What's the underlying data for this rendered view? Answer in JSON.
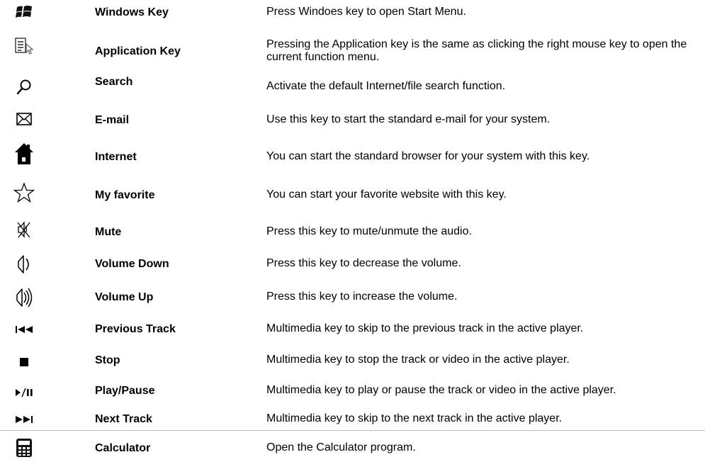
{
  "keys": [
    {
      "icon": "windows-logo-icon",
      "name": "Windows Key",
      "description": "Press Windoes key to open Start Menu."
    },
    {
      "icon": "application-menu-icon",
      "name": "Application Key",
      "description": "Pressing the Application key is the same as clicking the right mouse key to open the current function menu."
    },
    {
      "icon": "search-icon",
      "name": "Search",
      "description": "Activate the default Internet/file search function."
    },
    {
      "icon": "envelope-icon",
      "name": "E-mail",
      "description": "Use this key to start the standard e-mail for your system."
    },
    {
      "icon": "home-icon",
      "name": "Internet",
      "description": "You can start the standard browser for your system with this key."
    },
    {
      "icon": "star-icon",
      "name": "My favorite",
      "description": "You can start your favorite website with this key."
    },
    {
      "icon": "mute-icon",
      "name": "Mute",
      "description": "Press this key to mute/unmute the audio."
    },
    {
      "icon": "volume-down-icon",
      "name": "Volume Down",
      "description": "Press this key to decrease the volume."
    },
    {
      "icon": "volume-up-icon",
      "name": "Volume Up",
      "description": "Press this key to increase the volume."
    },
    {
      "icon": "previous-track-icon",
      "name": "Previous Track",
      "description": "Multimedia key to skip to the previous track in the active player."
    },
    {
      "icon": "stop-icon",
      "name": "Stop",
      "description": "Multimedia key to stop the track or video in the active player."
    },
    {
      "icon": "play-pause-icon",
      "name": "Play/Pause",
      "description": "Multimedia key to play or pause the track or video in the active player."
    },
    {
      "icon": "next-track-icon",
      "name": "Next Track",
      "description": "Multimedia key to skip to the next track in the active player."
    },
    {
      "icon": "calculator-icon",
      "name": "Calculator",
      "description": "Open the Calculator program."
    }
  ]
}
